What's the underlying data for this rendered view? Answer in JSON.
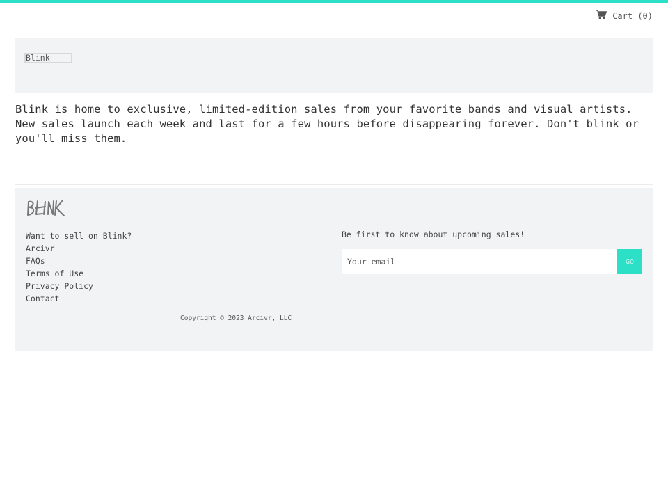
{
  "header": {
    "cart_icon": "cart-icon",
    "cart_label": "Cart (0)"
  },
  "hero": {
    "image_alt": "Blink"
  },
  "description": "Blink is home to exclusive, limited-edition sales from your favorite bands and visual artists. New sales launch each week and last for a few hours before disappearing forever. Don't blink or you'll miss them.",
  "footer": {
    "logo_text": "BLINK",
    "links": [
      {
        "label": "Want to sell on Blink?"
      },
      {
        "label": "Arcivr"
      },
      {
        "label": "FAQs"
      },
      {
        "label": "Terms of Use"
      },
      {
        "label": "Privacy Policy"
      },
      {
        "label": "Contact"
      }
    ],
    "newsletter": {
      "label": "Be first to know about upcoming sales!",
      "placeholder": "Your email",
      "button_label": "GO"
    },
    "copyright": "Copyright © 2023 Arcivr, LLC"
  },
  "colors": {
    "accent": "#2ce0c8",
    "panel": "#f2f3f5"
  }
}
